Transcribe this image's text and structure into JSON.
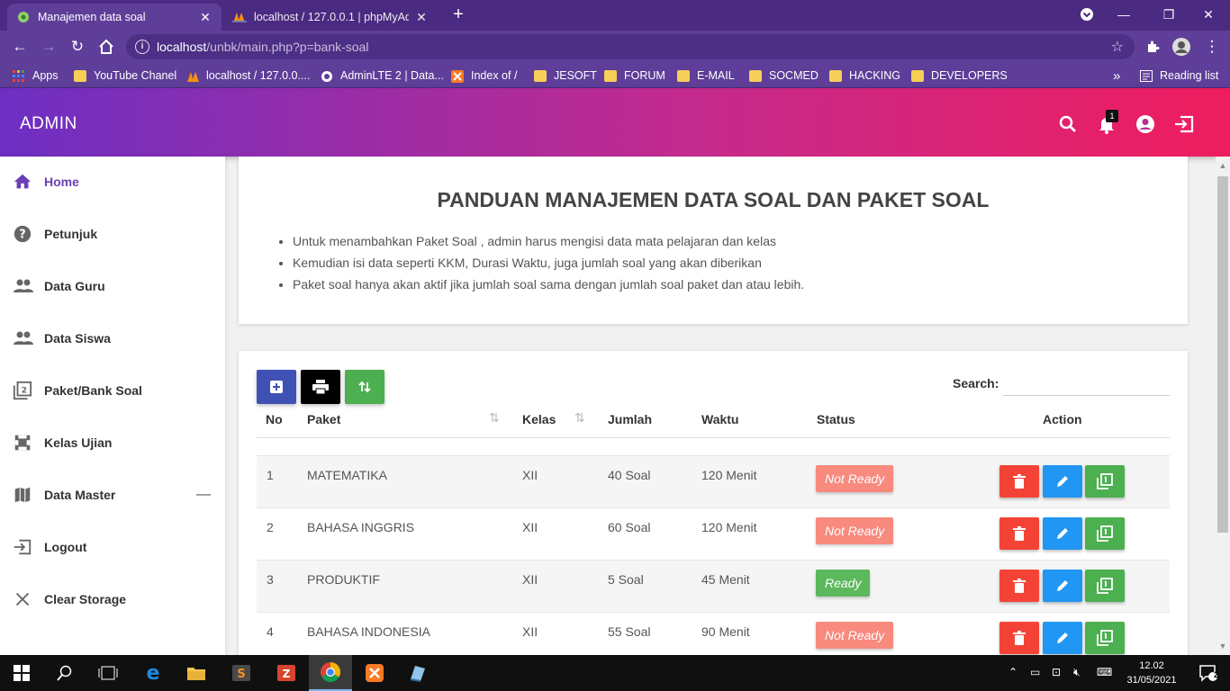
{
  "browser": {
    "tabs": [
      {
        "title": "Manajemen data soal",
        "active": true
      },
      {
        "title": "localhost / 127.0.0.1 | phpMyAdm",
        "active": false
      }
    ],
    "address": {
      "host": "localhost",
      "path": "/unbk/main.php?p=bank-soal"
    },
    "bookmarks": [
      "Apps",
      "YouTube Chanel",
      "localhost / 127.0.0....",
      "AdminLTE 2 | Data...",
      "Index of /",
      "JESOFT",
      "FORUM",
      "E-MAIL",
      "SOCMED",
      "HACKING",
      "DEVELOPERS"
    ],
    "reading_list": "Reading list",
    "more_bookmarks": "»"
  },
  "header": {
    "brand": "ADMIN",
    "notification_count": "1"
  },
  "sidebar": {
    "items": [
      {
        "label": "Home",
        "icon": "home-icon",
        "active": true
      },
      {
        "label": "Petunjuk",
        "icon": "help-icon"
      },
      {
        "label": "Data Guru",
        "icon": "people-icon"
      },
      {
        "label": "Data Siswa",
        "icon": "people-icon"
      },
      {
        "label": "Paket/Bank Soal",
        "icon": "filter-2-icon"
      },
      {
        "label": "Kelas Ujian",
        "icon": "class-icon"
      },
      {
        "label": "Data Master",
        "icon": "map-icon",
        "collapse": "—"
      },
      {
        "label": "Logout",
        "icon": "logout-icon"
      },
      {
        "label": "Clear Storage",
        "icon": "close-icon"
      }
    ]
  },
  "guide": {
    "title": "PANDUAN MANAJEMEN DATA SOAL DAN PAKET SOAL",
    "points": [
      "Untuk menambahkan Paket Soal , admin harus mengisi data mata pelajaran dan kelas",
      "Kemudian isi data seperti KKM, Durasi Waktu, juga jumlah soal yang akan diberikan",
      "Paket soal hanya akan aktif jika jumlah soal sama dengan jumlah soal paket dan atau lebih."
    ]
  },
  "table": {
    "search_label": "Search:",
    "search_value": "",
    "columns": [
      "No",
      "Paket",
      "Kelas",
      "Jumlah",
      "Waktu",
      "Status",
      "Action"
    ],
    "rows": [
      {
        "no": "1",
        "paket": "MATEMATIKA",
        "kelas": "XII",
        "jumlah": "40 Soal",
        "waktu": "120 Menit",
        "status": "Not Ready"
      },
      {
        "no": "2",
        "paket": "BAHASA INGGRIS",
        "kelas": "XII",
        "jumlah": "60 Soal",
        "waktu": "120 Menit",
        "status": "Not Ready"
      },
      {
        "no": "3",
        "paket": "PRODUKTIF",
        "kelas": "XII",
        "jumlah": "5 Soal",
        "waktu": "45 Menit",
        "status": "Ready"
      },
      {
        "no": "4",
        "paket": "BAHASA INDONESIA",
        "kelas": "XII",
        "jumlah": "55 Soal",
        "waktu": "90 Menit",
        "status": "Not Ready"
      }
    ]
  },
  "colors": {
    "not_ready": "#f88a7e",
    "ready": "#5cb85c",
    "delete": "#f44336",
    "edit": "#2196f3",
    "detail": "#4caf50",
    "add": "#3f51b5",
    "print": "#000000",
    "import": "#4caf50"
  },
  "taskbar": {
    "time": "12.02",
    "date": "31/05/2021",
    "notifications": "2"
  }
}
